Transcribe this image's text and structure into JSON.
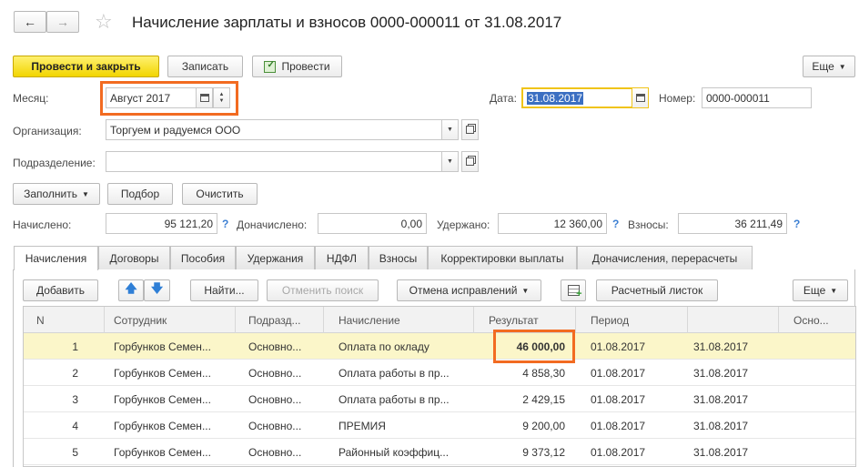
{
  "window": {
    "title": "Начисление зарплаты и взносов 0000-000011 от 31.08.2017",
    "back_icon": "arrow-left-icon",
    "forward_icon": "arrow-right-icon",
    "favorite_icon": "star-icon"
  },
  "toolbar": {
    "post_close": "Провести и закрыть",
    "save": "Записать",
    "post": "Провести",
    "more": "Еще"
  },
  "form": {
    "month_label": "Месяц:",
    "month_value": "Август 2017",
    "date_label": "Дата:",
    "date_value": "31.08.2017",
    "number_label": "Номер:",
    "number_value": "0000-000011",
    "org_label": "Организация:",
    "org_value": "Торгуем и радуемся ООО",
    "dept_label": "Подразделение:",
    "dept_value": ""
  },
  "actions": {
    "fill": "Заполнить",
    "pick": "Подбор",
    "clear": "Очистить"
  },
  "totals": {
    "accrued_label": "Начислено:",
    "accrued_value": "95 121,20",
    "extra_label": "Доначислено:",
    "extra_value": "0,00",
    "withheld_label": "Удержано:",
    "withheld_value": "12 360,00",
    "contrib_label": "Взносы:",
    "contrib_value": "36 211,49",
    "help": "?"
  },
  "tabs": [
    "Начисления",
    "Договоры",
    "Пособия",
    "Удержания",
    "НДФЛ",
    "Взносы",
    "Корректировки выплаты",
    "Доначисления, перерасчеты"
  ],
  "table_toolbar": {
    "add": "Добавить",
    "find": "Найти...",
    "cancel_search": "Отменить поиск",
    "cancel_corrections": "Отмена исправлений",
    "payslip": "Расчетный листок",
    "more": "Еще"
  },
  "table": {
    "columns": [
      "N",
      "Сотрудник",
      "Подразд...",
      "Начисление",
      "Результат",
      "Период",
      "",
      "Осно..."
    ],
    "rows": [
      [
        "1",
        "Горбунков Семен...",
        "Основно...",
        "Оплата по окладу",
        "46 000,00",
        "01.08.2017",
        "31.08.2017",
        ""
      ],
      [
        "2",
        "Горбунков Семен...",
        "Основно...",
        "Оплата работы в пр...",
        "4 858,30",
        "01.08.2017",
        "31.08.2017",
        ""
      ],
      [
        "3",
        "Горбунков Семен...",
        "Основно...",
        "Оплата работы в пр...",
        "2 429,15",
        "01.08.2017",
        "31.08.2017",
        ""
      ],
      [
        "4",
        "Горбунков Семен...",
        "Основно...",
        "ПРЕМИЯ",
        "9 200,00",
        "01.08.2017",
        "31.08.2017",
        ""
      ],
      [
        "5",
        "Горбунков Семен...",
        "Основно...",
        "Районный коэффиц...",
        "9 373,12",
        "01.08.2017",
        "31.08.2017",
        ""
      ]
    ]
  },
  "colors": {
    "accent_yellow": "#f2d500",
    "highlight_orange": "#f26b21",
    "selected_row": "#fbf6c9",
    "help_blue": "#3c7fd3"
  }
}
